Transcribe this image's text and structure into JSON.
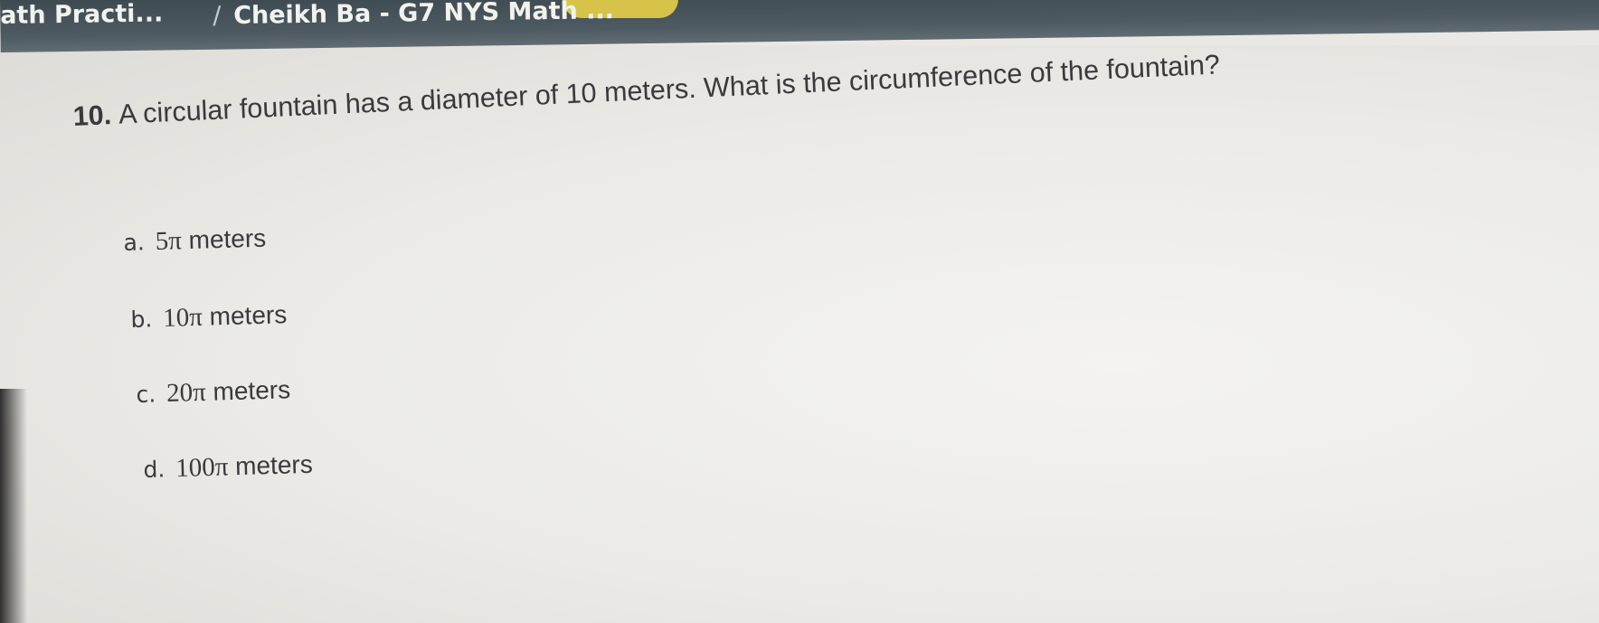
{
  "breadcrumb": {
    "item_1": "ath Practi...",
    "separator": "/",
    "item_2": "Cheikh Ba - G7 NYS Math ..."
  },
  "colors": {
    "topbar": "#434e56",
    "highlight": "#d7c34a",
    "text": "#3a3a3c",
    "page": "#ebeae6"
  },
  "question": {
    "number": "10.",
    "text": "A circular fountain has a diameter of 10 meters. What is the circumference of the fountain?"
  },
  "options": [
    {
      "letter": "a.",
      "value": "5π",
      "unit": "meters"
    },
    {
      "letter": "b.",
      "value": "10π",
      "unit": "meters"
    },
    {
      "letter": "c.",
      "value": "20π",
      "unit": "meters"
    },
    {
      "letter": "d.",
      "value": "100π",
      "unit": "meters"
    }
  ]
}
